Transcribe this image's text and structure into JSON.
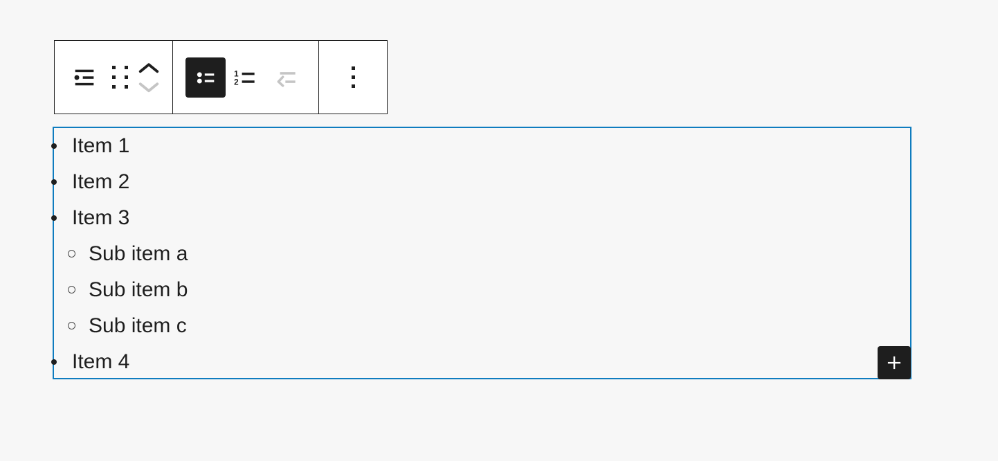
{
  "canvas": {
    "background_color": "#f7f7f7"
  },
  "toolbar": {
    "border_color": "#1e1e1e",
    "background_color": "#ffffff",
    "groups": [
      {
        "name": "block-type-and-movers",
        "items": [
          {
            "icon": "list-block-icon",
            "label": "List",
            "state": "enabled",
            "color": "#1e1e1e"
          },
          {
            "icon": "drag-handle-icon",
            "label": "Drag",
            "state": "enabled",
            "color": "#1e1e1e"
          },
          {
            "icon": "move-up-icon",
            "label": "Move up",
            "state": "enabled",
            "color": "#1e1e1e"
          },
          {
            "icon": "move-down-icon",
            "label": "Move down",
            "state": "disabled",
            "color": "#c5c5c5"
          }
        ]
      },
      {
        "name": "list-formatting",
        "items": [
          {
            "icon": "unordered-list-icon",
            "label": "Unordered list",
            "state": "pressed",
            "color": "#ffffff",
            "background_color": "#1e1e1e"
          },
          {
            "icon": "ordered-list-icon",
            "label": "Ordered list",
            "state": "enabled",
            "color": "#1e1e1e",
            "marker_one": "1",
            "marker_two": "2"
          },
          {
            "icon": "outdent-list-icon",
            "label": "Outdent",
            "state": "disabled",
            "color": "#c5c5c5"
          }
        ]
      },
      {
        "name": "more-options",
        "items": [
          {
            "icon": "more-options-vertical-dots-icon",
            "label": "Options",
            "state": "enabled",
            "color": "#1e1e1e"
          }
        ]
      }
    ]
  },
  "list_block": {
    "selected": true,
    "selection_border_color": "#0f7cbf",
    "text_color": "#1e1e1e",
    "items": [
      {
        "level": 1,
        "marker": "disc",
        "text": "Item 1"
      },
      {
        "level": 1,
        "marker": "disc",
        "text": "Item 2"
      },
      {
        "level": 1,
        "marker": "disc",
        "text": "Item 3"
      },
      {
        "level": 2,
        "marker": "circle",
        "text": "Sub item a"
      },
      {
        "level": 2,
        "marker": "circle",
        "text": "Sub item b"
      },
      {
        "level": 2,
        "marker": "circle",
        "text": "Sub item c"
      },
      {
        "level": 1,
        "marker": "disc",
        "text": "Item 4"
      }
    ]
  },
  "add_block_button": {
    "icon": "plus-icon",
    "label": "Add block",
    "background_color": "#1e1e1e",
    "icon_color": "#ffffff"
  }
}
